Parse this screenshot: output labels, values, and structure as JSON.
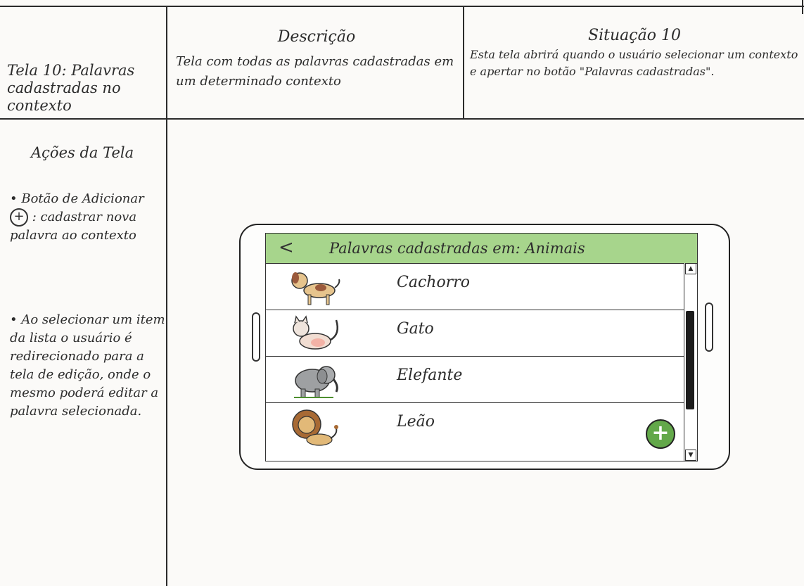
{
  "header": {
    "screen_title": "Tela 10: Palavras cadastradas no contexto",
    "description_heading": "Descrição",
    "description_text": "Tela com todas as palavras cadastradas em um determinado contexto",
    "situation_heading": "Situação 10",
    "situation_text": "Esta tela abrirá quando o usuário selecionar um contexto e apertar no botão \"Palavras cadastradas\"."
  },
  "actions": {
    "heading": "Ações da Tela",
    "add_button_label": "• Botão de Adicionar",
    "add_button_desc": ": cadastrar nova palavra ao contexto",
    "select_item_desc": "• Ao selecionar um item da lista o usuário é redirecionado para a tela de edição, onde o mesmo poderá editar a palavra selecionada."
  },
  "app": {
    "back_glyph": "<",
    "title": "Palavras cadastradas em: Animais",
    "words": [
      {
        "label": "Cachorro",
        "icon": "dog-icon"
      },
      {
        "label": "Gato",
        "icon": "cat-icon"
      },
      {
        "label": "Elefante",
        "icon": "elephant-icon"
      },
      {
        "label": "Leão",
        "icon": "lion-icon"
      }
    ],
    "add_glyph": "+",
    "appbar_color": "#a7d58c",
    "fab_color": "#63a84a"
  }
}
